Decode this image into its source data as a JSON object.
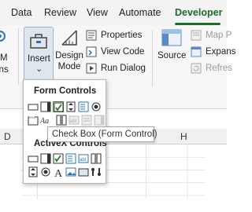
{
  "tabs": [
    {
      "label": "Data",
      "active": false
    },
    {
      "label": "Review",
      "active": false
    },
    {
      "label": "View",
      "active": false
    },
    {
      "label": "Automate",
      "active": false
    },
    {
      "label": "Developer",
      "active": true
    }
  ],
  "accent_color": "#1e6b2e",
  "ribbon": {
    "left_partial": {
      "label_line1": "M",
      "label_line2": "ins"
    },
    "insert": {
      "label": "Insert",
      "chevron": "⌄"
    },
    "design_mode": {
      "label_line1": "Design",
      "label_line2": "Mode"
    },
    "properties": {
      "label": "Properties"
    },
    "view_code": {
      "label": "View Code"
    },
    "run_dialog": {
      "label": "Run Dialog"
    },
    "source": {
      "label": "Source"
    },
    "map_properties": {
      "label": "Map P"
    },
    "expansion_packs": {
      "label": "Expans"
    },
    "refresh_data": {
      "label": "Refres"
    }
  },
  "columns": [
    "D",
    "H"
  ],
  "popup": {
    "form_controls_title": "Form Controls",
    "activex_controls_title": "ActiveX Controls",
    "form_controls_row1": [
      "button",
      "combo-box",
      "check-box",
      "spin-button",
      "list-box",
      "option-button"
    ],
    "form_controls_row2": [
      "group-box",
      "label",
      "scroll-bar",
      "text-field",
      "combo-list-edit",
      "combo-drop-down-edit"
    ],
    "activex_row1": [
      "command-button",
      "combo-box",
      "check-box",
      "list-box",
      "text-box",
      "scroll-bar"
    ],
    "activex_row2": [
      "spin-button",
      "option-button",
      "label",
      "image",
      "toggle-button",
      "more-controls"
    ]
  },
  "tooltip": {
    "text": "Check Box (Form Control)"
  }
}
